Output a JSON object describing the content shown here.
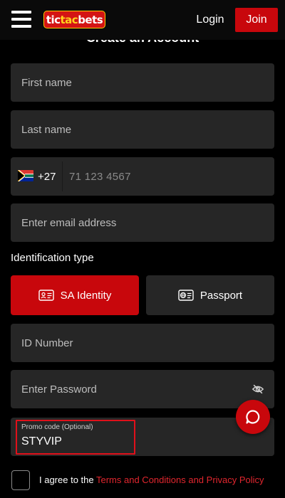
{
  "header": {
    "logo_left": "tic",
    "logo_mid": "tac",
    "logo_right": "bets",
    "login_label": "Login",
    "join_label": "Join"
  },
  "form": {
    "heading": "Create an Account",
    "first_name_placeholder": "First name",
    "last_name_placeholder": "Last name",
    "phone": {
      "country_code": "+27",
      "placeholder": "71 123 4567",
      "flag_icon": "south-africa-flag-icon"
    },
    "email_placeholder": "Enter email address",
    "identification": {
      "label": "Identification type",
      "options": [
        {
          "label": "SA Identity",
          "selected": true,
          "icon": "id-card-icon"
        },
        {
          "label": "Passport",
          "selected": false,
          "icon": "passport-icon"
        }
      ]
    },
    "id_number_placeholder": "ID Number",
    "password_placeholder": "Enter Password",
    "promo": {
      "label": "Promo code (Optional)",
      "value": "STYVIP"
    },
    "agreement": {
      "prefix": "I agree to the ",
      "link": "Terms and Conditions and Privacy Policy"
    }
  },
  "colors": {
    "brand_red": "#c8070c",
    "field_bg": "#262626",
    "page_bg": "#000000",
    "link_red": "#e1262e",
    "highlight_border": "#e0101a"
  }
}
